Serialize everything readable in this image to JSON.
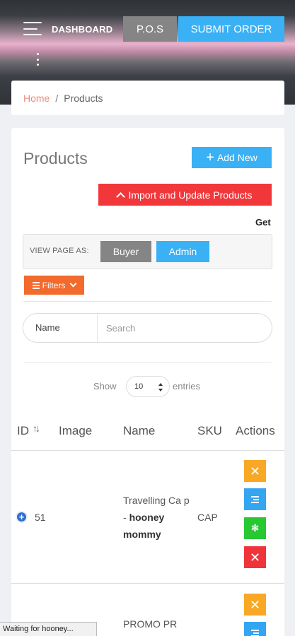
{
  "header": {
    "dashboard_label": "DASHBOARD",
    "pos_button": "P.O.S",
    "submit_button": "SUBMIT ORDER"
  },
  "breadcrumb": {
    "home": "Home",
    "separator": "/",
    "current": "Products"
  },
  "page": {
    "title": "Products",
    "add_new": "Add New",
    "import_update": "Import and Update Products",
    "get_text": "Get"
  },
  "view_as": {
    "label": "VIEW PAGE AS:",
    "buyer": "Buyer",
    "admin": "Admin"
  },
  "filters": {
    "label": "Filters"
  },
  "search": {
    "field_label": "Name",
    "placeholder": "Search"
  },
  "pagination": {
    "show_label": "Show",
    "page_size": "10",
    "entries_label": "entries"
  },
  "table": {
    "columns": [
      "ID",
      "Image",
      "Name",
      "SKU",
      "Actions"
    ],
    "rows": [
      {
        "id": "51",
        "name_prefix": "Travelling Ca p - ",
        "name_bold": "hooney mommy",
        "sku": "CAP"
      },
      {
        "id": "",
        "name_prefix": "PROMO PR",
        "name_bold": "",
        "sku": ""
      }
    ]
  },
  "status_bar": {
    "text": "Waiting for hooney..."
  },
  "colors": {
    "accent_blue": "#3ab0f5",
    "gray_button": "#858585",
    "danger_red": "#f2373b",
    "filter_orange": "#f26a2c",
    "action_orange": "#f8a825",
    "action_green": "#28c832"
  }
}
